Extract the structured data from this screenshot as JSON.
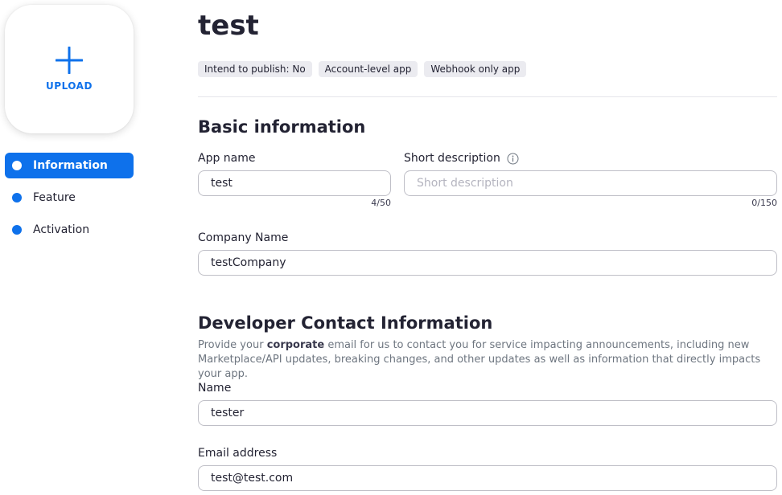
{
  "sidebar": {
    "upload_label": "UPLOAD",
    "upload_icon": "plus-icon",
    "items": [
      {
        "label": "Information",
        "active": true
      },
      {
        "label": "Feature",
        "active": false
      },
      {
        "label": "Activation",
        "active": false
      }
    ]
  },
  "header": {
    "title": "test",
    "tags": [
      "Intend to publish: No",
      "Account-level app",
      "Webhook only app"
    ]
  },
  "basic": {
    "section_title": "Basic information",
    "app_name": {
      "label": "App name",
      "value": "test",
      "counter": "4/50"
    },
    "short_description": {
      "label": "Short description",
      "placeholder": "Short description",
      "value": "",
      "counter": "0/150",
      "icon": "info-icon"
    },
    "company_name": {
      "label": "Company Name",
      "value": "testCompany"
    }
  },
  "developer": {
    "section_title": "Developer Contact Information",
    "description_prefix": "Provide your ",
    "description_bold": "corporate",
    "description_suffix": " email for us to contact you for service impacting announcements, including new Marketplace/API updates, breaking changes, and other updates as well as information that directly impacts your app.",
    "name": {
      "label": "Name",
      "value": "tester"
    },
    "email": {
      "label": "Email address",
      "value": "test@test.com"
    }
  },
  "colors": {
    "accent": "#0e71eb",
    "tag_bg": "#ebebf0",
    "text": "#232333",
    "muted": "#6e7680"
  }
}
